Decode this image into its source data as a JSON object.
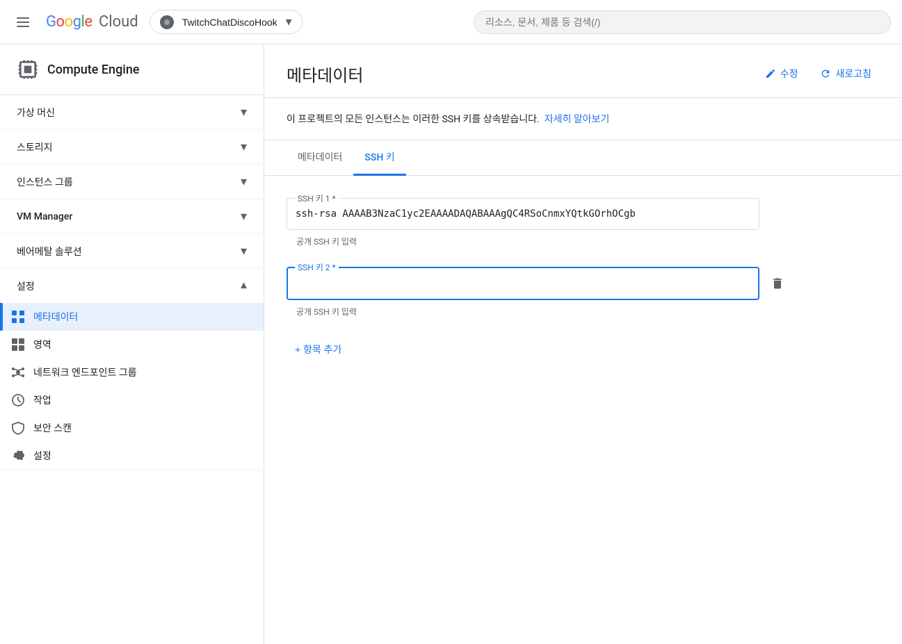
{
  "topNav": {
    "hamburger_label": "☰",
    "google_text": "Google",
    "cloud_text": "Cloud",
    "project_name": "TwitchChatDiscoHook",
    "search_placeholder": "리소스, 문서, 제품 등 검색(/)"
  },
  "sidebar": {
    "title": "Compute Engine",
    "sections": [
      {
        "id": "vm",
        "label": "가상 머신",
        "expanded": false
      },
      {
        "id": "storage",
        "label": "스토리지",
        "expanded": false
      },
      {
        "id": "instance-groups",
        "label": "인스턴스 그룹",
        "expanded": false
      },
      {
        "id": "vm-manager",
        "label": "VM Manager",
        "expanded": false
      },
      {
        "id": "bare-metal",
        "label": "베어메탈 솔루션",
        "expanded": false
      },
      {
        "id": "settings",
        "label": "설정",
        "expanded": true
      }
    ],
    "settingsItems": [
      {
        "id": "metadata",
        "label": "메타데이터",
        "active": true,
        "icon": "grid"
      },
      {
        "id": "zones",
        "label": "영역",
        "active": false,
        "icon": "zones"
      },
      {
        "id": "network-endpoints",
        "label": "네트워크 엔드포인트 그룹",
        "active": false,
        "icon": "network"
      },
      {
        "id": "jobs",
        "label": "작업",
        "active": false,
        "icon": "clock"
      },
      {
        "id": "security-scan",
        "label": "보안 스캔",
        "active": false,
        "icon": "shield"
      },
      {
        "id": "settings-item",
        "label": "설정",
        "active": false,
        "icon": "gear"
      }
    ]
  },
  "page": {
    "title": "메타데이터",
    "edit_btn": "수정",
    "refresh_btn": "새로고침",
    "info_text": "이 프로젝트의 모든 인스턴스는 이러한 SSH 키를 상속받습니다.",
    "learn_more": "자세히 알아보기"
  },
  "tabs": [
    {
      "id": "metadata-tab",
      "label": "메타데이터",
      "active": false
    },
    {
      "id": "ssh-tab",
      "label": "SSH 키",
      "active": true
    }
  ],
  "sshKeys": [
    {
      "id": "ssh-key-1",
      "label": "SSH 키 1",
      "value": "ssh-rsa AAAAB3NzaC1yc2EAAAADAQABAAAgQC4RSoCnmxYQtkGOrhOCgb",
      "placeholder": "공개 SSH 키 입력",
      "focused": false
    },
    {
      "id": "ssh-key-2",
      "label": "SSH 키 2",
      "value": "",
      "placeholder": "공개 SSH 키 입력",
      "focused": true
    }
  ],
  "addItemBtn": "+ 항목 추가"
}
